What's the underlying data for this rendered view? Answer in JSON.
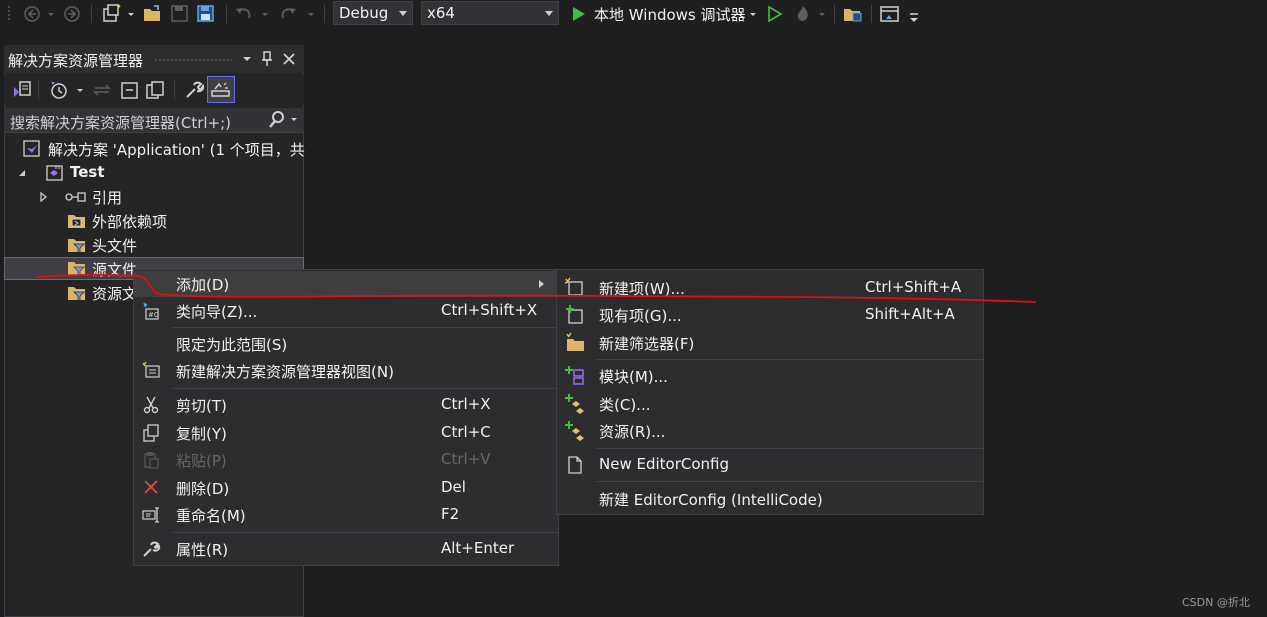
{
  "toolbar": {
    "config": "Debug",
    "platform": "x64",
    "debugger": "本地 Windows 调试器"
  },
  "panel": {
    "title": "解决方案资源管理器",
    "search_placeholder": "搜索解决方案资源管理器(Ctrl+;)"
  },
  "tree": {
    "solution": "解决方案 'Application' (1 个项目，共",
    "project": "Test",
    "references": "引用",
    "external_deps": "外部依赖项",
    "header_files": "头文件",
    "source_files": "源文件",
    "resource_files": "资源文"
  },
  "context_menu": {
    "add": "添加(D)",
    "class_wizard": "类向导(Z)...",
    "class_wizard_shortcut": "Ctrl+Shift+X",
    "scope": "限定为此范围(S)",
    "new_view": "新建解决方案资源管理器视图(N)",
    "cut": "剪切(T)",
    "cut_shortcut": "Ctrl+X",
    "copy": "复制(Y)",
    "copy_shortcut": "Ctrl+C",
    "paste": "粘贴(P)",
    "paste_shortcut": "Ctrl+V",
    "delete": "删除(D)",
    "delete_shortcut": "Del",
    "rename": "重命名(M)",
    "rename_shortcut": "F2",
    "properties": "属性(R)",
    "properties_shortcut": "Alt+Enter"
  },
  "submenu": {
    "new_item": "新建项(W)...",
    "new_item_shortcut": "Ctrl+Shift+A",
    "existing_item": "现有项(G)...",
    "existing_item_shortcut": "Shift+Alt+A",
    "new_filter": "新建筛选器(F)",
    "module": "模块(M)...",
    "class": "类(C)...",
    "resource": "资源(R)...",
    "new_editorconfig": "New EditorConfig",
    "new_editorconfig_intellicode": "新建 EditorConfig (IntelliCode)"
  },
  "watermark": "CSDN @折北",
  "colors": {
    "accent": "#6c6cf0",
    "play_green": "#3cc13c",
    "annotation_red": "#e01010",
    "delete_red": "#e04a4a",
    "background": "#1e1e1e"
  }
}
